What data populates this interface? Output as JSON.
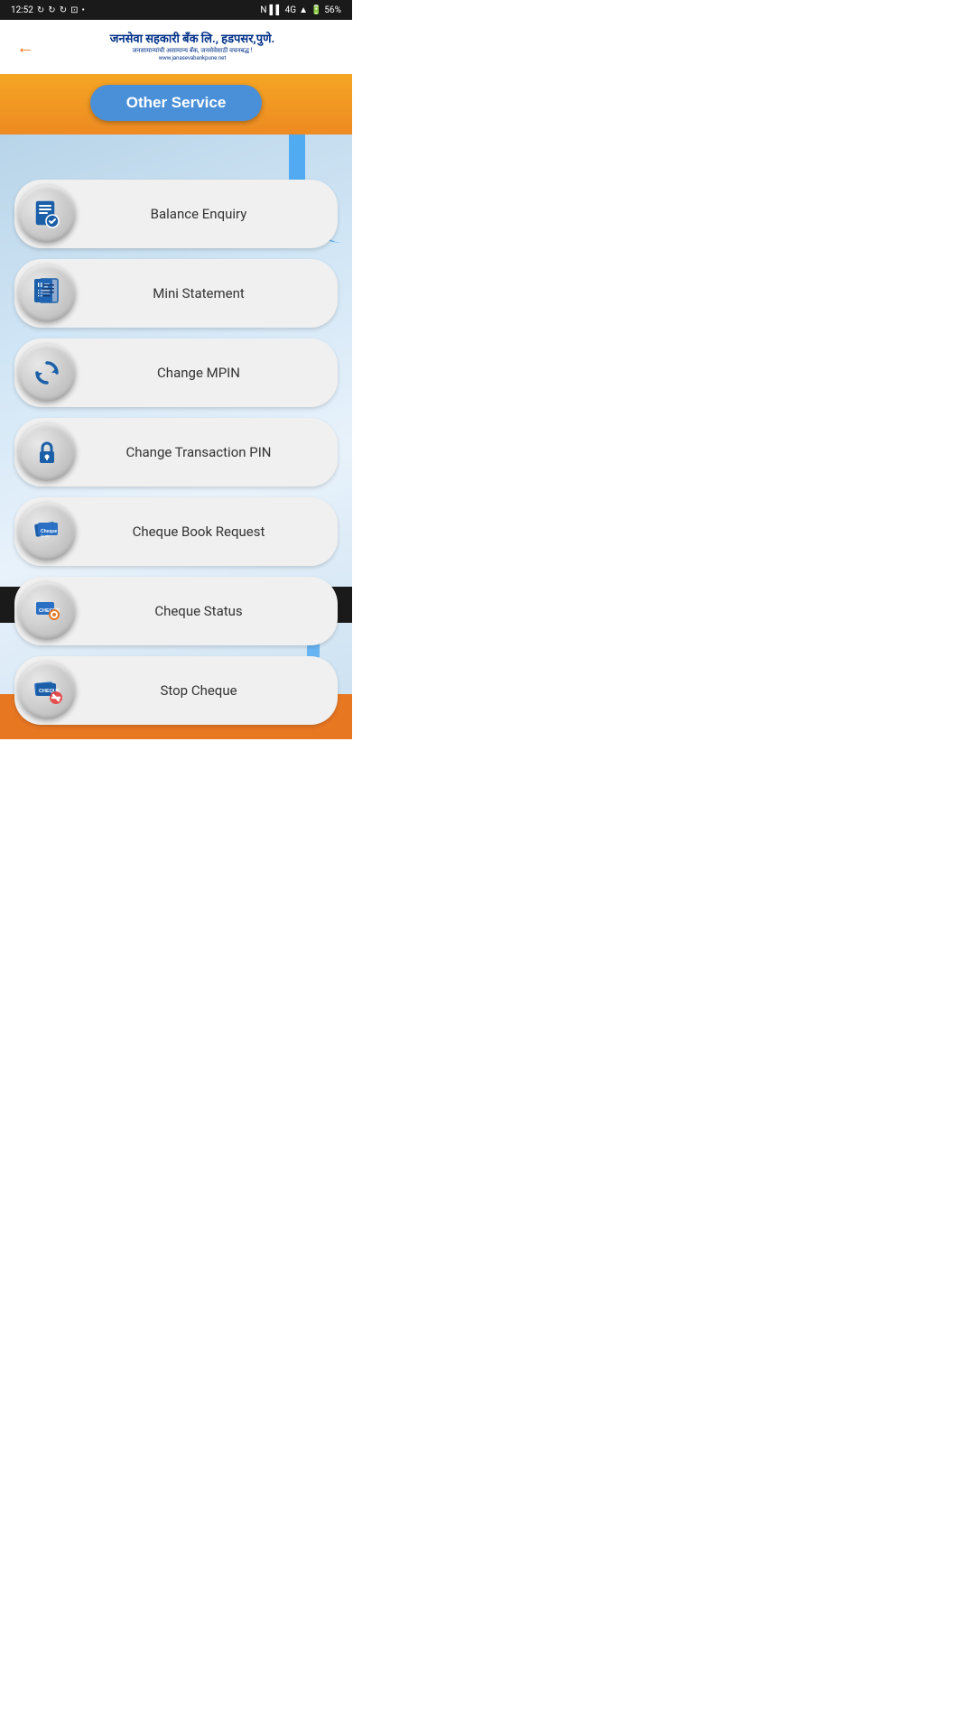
{
  "status_bar": {
    "time": "12:52",
    "battery": "56%",
    "network": "4G"
  },
  "header": {
    "back_icon": "←",
    "bank_name": "जनसेवा सहकारी बँक लि., हडपसर,पुणे.",
    "bank_tagline": "जनसामान्यांची असामान्य बँक, जनसेवेसाठी वचनबद्ध !",
    "bank_website": "www.janasevabankpune.net"
  },
  "page_title": "Other Service",
  "services": [
    {
      "id": "balance-enquiry",
      "label": "Balance Enquiry",
      "icon": "balance"
    },
    {
      "id": "mini-statement",
      "label": "Mini Statement",
      "icon": "statement"
    },
    {
      "id": "change-mpin",
      "label": "Change MPIN",
      "icon": "refresh"
    },
    {
      "id": "change-transaction-pin",
      "label": "Change Transaction PIN",
      "icon": "lock"
    },
    {
      "id": "cheque-book-request",
      "label": "Cheque Book Request",
      "icon": "chequebook"
    },
    {
      "id": "cheque-status",
      "label": "Cheque Status",
      "icon": "chequestatus"
    },
    {
      "id": "stop-cheque",
      "label": "Stop Cheque",
      "icon": "stopcheque"
    }
  ],
  "nav": {
    "back_icon": "◁",
    "home_icon": "●",
    "recent_icon": "■"
  }
}
